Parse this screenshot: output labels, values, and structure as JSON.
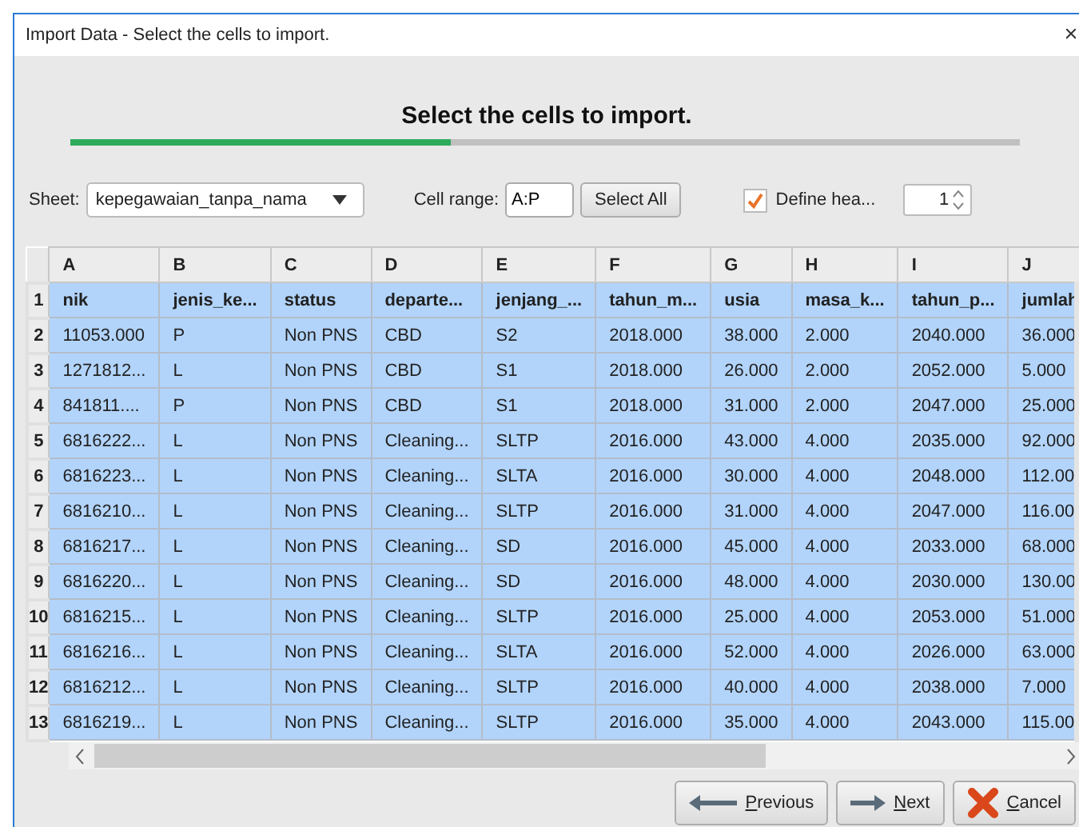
{
  "window": {
    "title": "Import Data - Select the cells to import."
  },
  "heading": "Select the cells to import.",
  "progress": {
    "level": 0.4
  },
  "toolbar": {
    "sheet_label": "Sheet:",
    "sheet_value": "kepegawaian_tanpa_nama",
    "range_label": "Cell range:",
    "range_value": "A:P",
    "select_all": "Select All",
    "define_header": {
      "label": "Define hea...",
      "checked": true
    },
    "header_rows": "1"
  },
  "table": {
    "columns": [
      "A",
      "B",
      "C",
      "D",
      "E",
      "F",
      "G",
      "H",
      "I",
      "J"
    ],
    "rows": [
      {
        "number": "1",
        "kind": "header",
        "selected": true,
        "cells": [
          "nik",
          "jenis_ke...",
          "status",
          "departe...",
          "jenjang_...",
          "tahun_m...",
          "usia",
          "masa_k...",
          "tahun_p...",
          "jumlah"
        ]
      },
      {
        "number": "2",
        "kind": "data",
        "selected": true,
        "cells": [
          "11053.000",
          "P",
          "Non PNS",
          "CBD",
          "S2",
          "2018.000",
          "38.000",
          "2.000",
          "2040.000",
          "36.000"
        ]
      },
      {
        "number": "3",
        "kind": "data",
        "selected": true,
        "cells": [
          "1271812...",
          "L",
          "Non PNS",
          "CBD",
          "S1",
          "2018.000",
          "26.000",
          "2.000",
          "2052.000",
          "5.000"
        ]
      },
      {
        "number": "4",
        "kind": "data",
        "selected": true,
        "cells": [
          "841811....",
          "P",
          "Non PNS",
          "CBD",
          "S1",
          "2018.000",
          "31.000",
          "2.000",
          "2047.000",
          "25.000"
        ]
      },
      {
        "number": "5",
        "kind": "data",
        "selected": true,
        "cells": [
          "6816222...",
          "L",
          "Non PNS",
          "Cleaning...",
          "SLTP",
          "2016.000",
          "43.000",
          "4.000",
          "2035.000",
          "92.000"
        ]
      },
      {
        "number": "6",
        "kind": "data",
        "selected": true,
        "cells": [
          "6816223...",
          "L",
          "Non PNS",
          "Cleaning...",
          "SLTA",
          "2016.000",
          "30.000",
          "4.000",
          "2048.000",
          "112.00"
        ]
      },
      {
        "number": "7",
        "kind": "data",
        "selected": true,
        "cells": [
          "6816210...",
          "L",
          "Non PNS",
          "Cleaning...",
          "SLTP",
          "2016.000",
          "31.000",
          "4.000",
          "2047.000",
          "116.00"
        ]
      },
      {
        "number": "8",
        "kind": "data",
        "selected": true,
        "cells": [
          "6816217...",
          "L",
          "Non PNS",
          "Cleaning...",
          "SD",
          "2016.000",
          "45.000",
          "4.000",
          "2033.000",
          "68.000"
        ]
      },
      {
        "number": "9",
        "kind": "data",
        "selected": true,
        "cells": [
          "6816220...",
          "L",
          "Non PNS",
          "Cleaning...",
          "SD",
          "2016.000",
          "48.000",
          "4.000",
          "2030.000",
          "130.00"
        ]
      },
      {
        "number": "10",
        "kind": "data",
        "selected": true,
        "cells": [
          "6816215...",
          "L",
          "Non PNS",
          "Cleaning...",
          "SLTP",
          "2016.000",
          "25.000",
          "4.000",
          "2053.000",
          "51.000"
        ]
      },
      {
        "number": "11",
        "kind": "data",
        "selected": true,
        "cells": [
          "6816216...",
          "L",
          "Non PNS",
          "Cleaning...",
          "SLTA",
          "2016.000",
          "52.000",
          "4.000",
          "2026.000",
          "63.000"
        ]
      },
      {
        "number": "12",
        "kind": "data",
        "selected": true,
        "cells": [
          "6816212...",
          "L",
          "Non PNS",
          "Cleaning...",
          "SLTP",
          "2016.000",
          "40.000",
          "4.000",
          "2038.000",
          "7.000"
        ]
      },
      {
        "number": "13",
        "kind": "data",
        "selected": true,
        "cells": [
          "6816219...",
          "L",
          "Non PNS",
          "Cleaning...",
          "SLTP",
          "2016.000",
          "35.000",
          "4.000",
          "2043.000",
          "115.00"
        ]
      }
    ]
  },
  "buttons": [
    {
      "kind": "previous",
      "label": "Previous"
    },
    {
      "kind": "next",
      "label": "Next"
    },
    {
      "kind": "cancel",
      "label": "Cancel"
    }
  ]
}
